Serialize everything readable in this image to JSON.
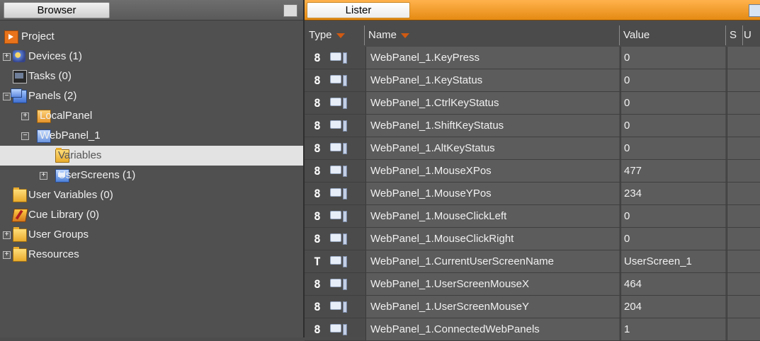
{
  "browser": {
    "tab_label": "Browser",
    "tree": [
      {
        "label": "Project",
        "icon": "project-icon",
        "level": 0,
        "expander": ""
      },
      {
        "label": "Devices (1)",
        "icon": "devices-icon",
        "level": 0,
        "expander": "+"
      },
      {
        "label": "Tasks (0)",
        "icon": "tasks-icon",
        "level": 0,
        "expander": ""
      },
      {
        "label": "Panels (2)",
        "icon": "panels-icon",
        "level": 0,
        "expander": "−"
      },
      {
        "label": "LocalPanel",
        "icon": "local-panel-icon",
        "level": 1,
        "expander": "+"
      },
      {
        "label": "WebPanel_1",
        "icon": "web-panel-icon",
        "level": 1,
        "expander": "−"
      },
      {
        "label": "Variables",
        "icon": "folder-icon",
        "level": 2,
        "expander": "",
        "selected": true
      },
      {
        "label": "UserScreens (1)",
        "icon": "user-screens-icon",
        "level": 2,
        "expander": "+"
      },
      {
        "label": "User Variables (0)",
        "icon": "folder-icon",
        "level": 0,
        "expander": ""
      },
      {
        "label": "Cue Library (0)",
        "icon": "cue-icon",
        "level": 0,
        "expander": ""
      },
      {
        "label": "User Groups",
        "icon": "folder-icon",
        "level": 0,
        "expander": "+"
      },
      {
        "label": "Resources",
        "icon": "folder-icon",
        "level": 0,
        "expander": "+"
      }
    ]
  },
  "lister": {
    "tab_label": "Lister",
    "columns": {
      "type": "Type",
      "name": "Name",
      "value": "Value",
      "s": "S",
      "u": "U"
    },
    "rows": [
      {
        "type": "8",
        "name": "WebPanel_1.KeyPress",
        "value": "0"
      },
      {
        "type": "8",
        "name": "WebPanel_1.KeyStatus",
        "value": "0"
      },
      {
        "type": "8",
        "name": "WebPanel_1.CtrlKeyStatus",
        "value": "0"
      },
      {
        "type": "8",
        "name": "WebPanel_1.ShiftKeyStatus",
        "value": "0"
      },
      {
        "type": "8",
        "name": "WebPanel_1.AltKeyStatus",
        "value": "0"
      },
      {
        "type": "8",
        "name": "WebPanel_1.MouseXPos",
        "value": "477"
      },
      {
        "type": "8",
        "name": "WebPanel_1.MouseYPos",
        "value": "234"
      },
      {
        "type": "8",
        "name": "WebPanel_1.MouseClickLeft",
        "value": "0"
      },
      {
        "type": "8",
        "name": "WebPanel_1.MouseClickRight",
        "value": "0"
      },
      {
        "type": "T",
        "name": "WebPanel_1.CurrentUserScreenName",
        "value": "UserScreen_1"
      },
      {
        "type": "8",
        "name": "WebPanel_1.UserScreenMouseX",
        "value": "464"
      },
      {
        "type": "8",
        "name": "WebPanel_1.UserScreenMouseY",
        "value": "204"
      },
      {
        "type": "8",
        "name": "WebPanel_1.ConnectedWebPanels",
        "value": "1"
      }
    ]
  }
}
